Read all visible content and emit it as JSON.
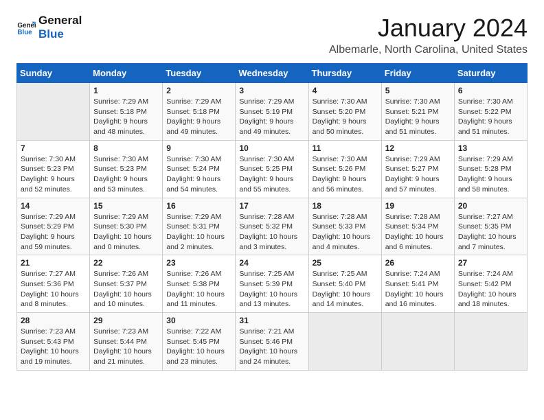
{
  "logo": {
    "line1": "General",
    "line2": "Blue"
  },
  "title": "January 2024",
  "subtitle": "Albemarle, North Carolina, United States",
  "days_of_week": [
    "Sunday",
    "Monday",
    "Tuesday",
    "Wednesday",
    "Thursday",
    "Friday",
    "Saturday"
  ],
  "weeks": [
    [
      {
        "day": null
      },
      {
        "day": 1,
        "sunrise": "7:29 AM",
        "sunset": "5:18 PM",
        "daylight": "9 hours and 48 minutes."
      },
      {
        "day": 2,
        "sunrise": "7:29 AM",
        "sunset": "5:18 PM",
        "daylight": "9 hours and 49 minutes."
      },
      {
        "day": 3,
        "sunrise": "7:29 AM",
        "sunset": "5:19 PM",
        "daylight": "9 hours and 49 minutes."
      },
      {
        "day": 4,
        "sunrise": "7:30 AM",
        "sunset": "5:20 PM",
        "daylight": "9 hours and 50 minutes."
      },
      {
        "day": 5,
        "sunrise": "7:30 AM",
        "sunset": "5:21 PM",
        "daylight": "9 hours and 51 minutes."
      },
      {
        "day": 6,
        "sunrise": "7:30 AM",
        "sunset": "5:22 PM",
        "daylight": "9 hours and 51 minutes."
      }
    ],
    [
      {
        "day": 7,
        "sunrise": "7:30 AM",
        "sunset": "5:23 PM",
        "daylight": "9 hours and 52 minutes."
      },
      {
        "day": 8,
        "sunrise": "7:30 AM",
        "sunset": "5:23 PM",
        "daylight": "9 hours and 53 minutes."
      },
      {
        "day": 9,
        "sunrise": "7:30 AM",
        "sunset": "5:24 PM",
        "daylight": "9 hours and 54 minutes."
      },
      {
        "day": 10,
        "sunrise": "7:30 AM",
        "sunset": "5:25 PM",
        "daylight": "9 hours and 55 minutes."
      },
      {
        "day": 11,
        "sunrise": "7:30 AM",
        "sunset": "5:26 PM",
        "daylight": "9 hours and 56 minutes."
      },
      {
        "day": 12,
        "sunrise": "7:29 AM",
        "sunset": "5:27 PM",
        "daylight": "9 hours and 57 minutes."
      },
      {
        "day": 13,
        "sunrise": "7:29 AM",
        "sunset": "5:28 PM",
        "daylight": "9 hours and 58 minutes."
      }
    ],
    [
      {
        "day": 14,
        "sunrise": "7:29 AM",
        "sunset": "5:29 PM",
        "daylight": "9 hours and 59 minutes."
      },
      {
        "day": 15,
        "sunrise": "7:29 AM",
        "sunset": "5:30 PM",
        "daylight": "10 hours and 0 minutes."
      },
      {
        "day": 16,
        "sunrise": "7:29 AM",
        "sunset": "5:31 PM",
        "daylight": "10 hours and 2 minutes."
      },
      {
        "day": 17,
        "sunrise": "7:28 AM",
        "sunset": "5:32 PM",
        "daylight": "10 hours and 3 minutes."
      },
      {
        "day": 18,
        "sunrise": "7:28 AM",
        "sunset": "5:33 PM",
        "daylight": "10 hours and 4 minutes."
      },
      {
        "day": 19,
        "sunrise": "7:28 AM",
        "sunset": "5:34 PM",
        "daylight": "10 hours and 6 minutes."
      },
      {
        "day": 20,
        "sunrise": "7:27 AM",
        "sunset": "5:35 PM",
        "daylight": "10 hours and 7 minutes."
      }
    ],
    [
      {
        "day": 21,
        "sunrise": "7:27 AM",
        "sunset": "5:36 PM",
        "daylight": "10 hours and 8 minutes."
      },
      {
        "day": 22,
        "sunrise": "7:26 AM",
        "sunset": "5:37 PM",
        "daylight": "10 hours and 10 minutes."
      },
      {
        "day": 23,
        "sunrise": "7:26 AM",
        "sunset": "5:38 PM",
        "daylight": "10 hours and 11 minutes."
      },
      {
        "day": 24,
        "sunrise": "7:25 AM",
        "sunset": "5:39 PM",
        "daylight": "10 hours and 13 minutes."
      },
      {
        "day": 25,
        "sunrise": "7:25 AM",
        "sunset": "5:40 PM",
        "daylight": "10 hours and 14 minutes."
      },
      {
        "day": 26,
        "sunrise": "7:24 AM",
        "sunset": "5:41 PM",
        "daylight": "10 hours and 16 minutes."
      },
      {
        "day": 27,
        "sunrise": "7:24 AM",
        "sunset": "5:42 PM",
        "daylight": "10 hours and 18 minutes."
      }
    ],
    [
      {
        "day": 28,
        "sunrise": "7:23 AM",
        "sunset": "5:43 PM",
        "daylight": "10 hours and 19 minutes."
      },
      {
        "day": 29,
        "sunrise": "7:23 AM",
        "sunset": "5:44 PM",
        "daylight": "10 hours and 21 minutes."
      },
      {
        "day": 30,
        "sunrise": "7:22 AM",
        "sunset": "5:45 PM",
        "daylight": "10 hours and 23 minutes."
      },
      {
        "day": 31,
        "sunrise": "7:21 AM",
        "sunset": "5:46 PM",
        "daylight": "10 hours and 24 minutes."
      },
      {
        "day": null
      },
      {
        "day": null
      },
      {
        "day": null
      }
    ]
  ]
}
